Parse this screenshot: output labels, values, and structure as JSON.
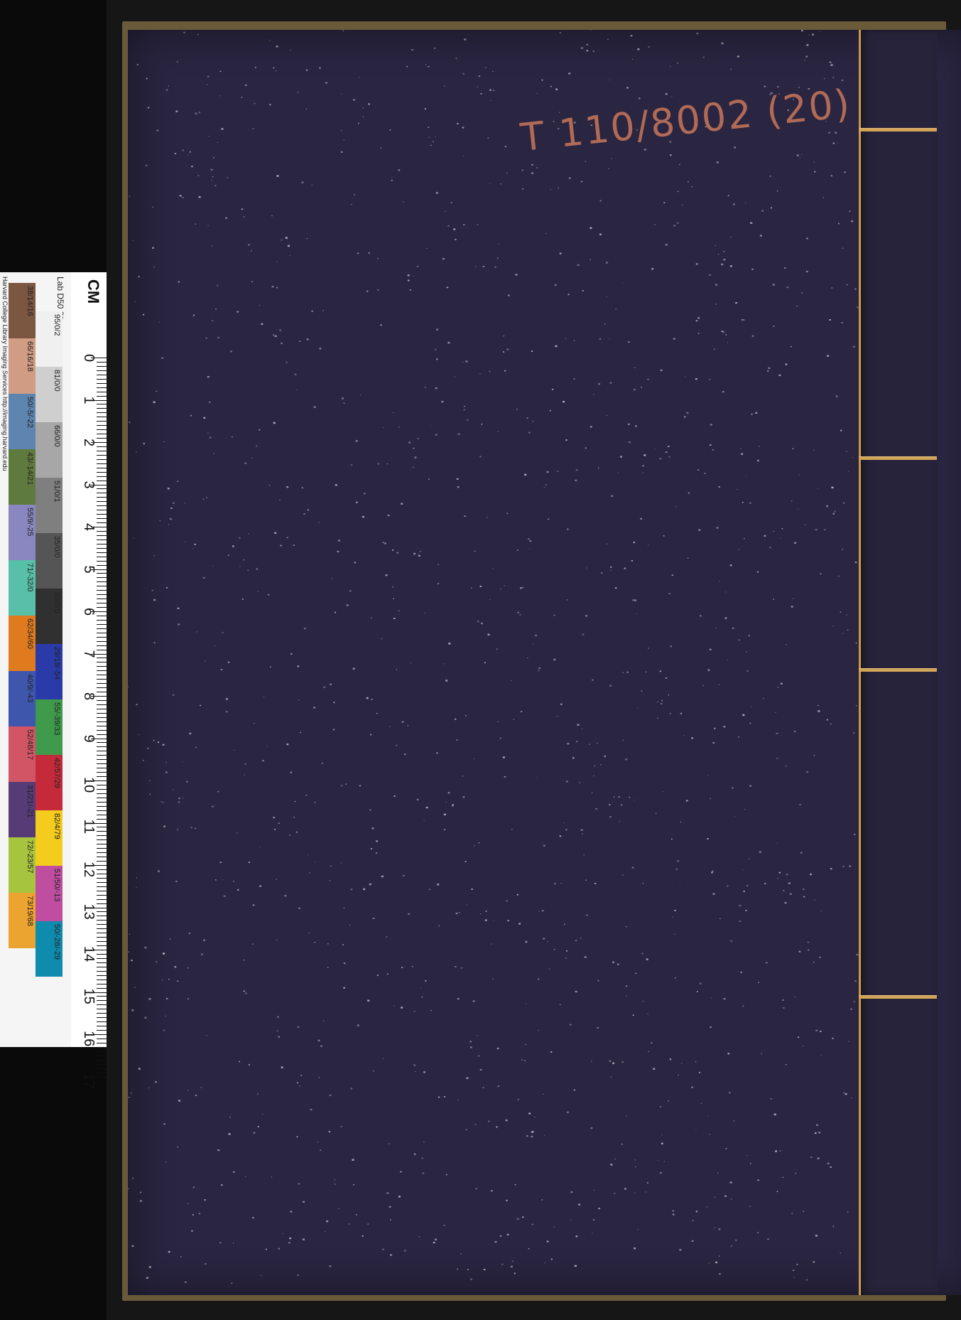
{
  "call_number": "T 110/8002 (20)",
  "target": {
    "cm_label": "CM",
    "lab_label": "Lab D50 2°",
    "credit": "Harvard College Library Imaging Services http://imaging.harvard.edu",
    "ruler_numbers": [
      "0",
      "1",
      "2",
      "3",
      "4",
      "5",
      "6",
      "7",
      "8",
      "9",
      "10",
      "11",
      "12",
      "13",
      "14",
      "15",
      "16",
      "17"
    ],
    "top_row": [
      {
        "label": "95/0/2",
        "color": "#f0f0f0"
      },
      {
        "label": "81/0/0",
        "color": "#cfcfcf"
      },
      {
        "label": "66/0/0",
        "color": "#a7a7a7"
      },
      {
        "label": "51/0/1",
        "color": "#7f7f7f"
      },
      {
        "label": "35/0/0",
        "color": "#555555"
      },
      {
        "label": "20/0/0",
        "color": "#303030"
      },
      {
        "label": "29/19/-54",
        "color": "#2a3aa8"
      },
      {
        "label": "55/-39/33",
        "color": "#3f9a4c"
      },
      {
        "label": "42/57/29",
        "color": "#c52a3a"
      },
      {
        "label": "82/4/79",
        "color": "#f3cc1d"
      },
      {
        "label": "51/50/-13",
        "color": "#c04ea0"
      },
      {
        "label": "50/-28/-29",
        "color": "#0f8cad"
      }
    ],
    "bottom_row": [
      {
        "label": "38/14/16",
        "color": "#7b5742"
      },
      {
        "label": "66/16/18",
        "color": "#d19c84"
      },
      {
        "label": "50/-5/-22",
        "color": "#5d85b0"
      },
      {
        "label": "43/-14/21",
        "color": "#5f7a3e"
      },
      {
        "label": "55/9/-25",
        "color": "#8a86c0"
      },
      {
        "label": "71/-32/0",
        "color": "#58c0a8"
      },
      {
        "label": "62/34/60",
        "color": "#e07a1f"
      },
      {
        "label": "40/9/-43",
        "color": "#3f56ad"
      },
      {
        "label": "52/48/17",
        "color": "#d25566"
      },
      {
        "label": "31/21/-21",
        "color": "#573b77"
      },
      {
        "label": "72/-23/57",
        "color": "#a7c43f"
      },
      {
        "label": "73/19/68",
        "color": "#eca431"
      }
    ]
  }
}
